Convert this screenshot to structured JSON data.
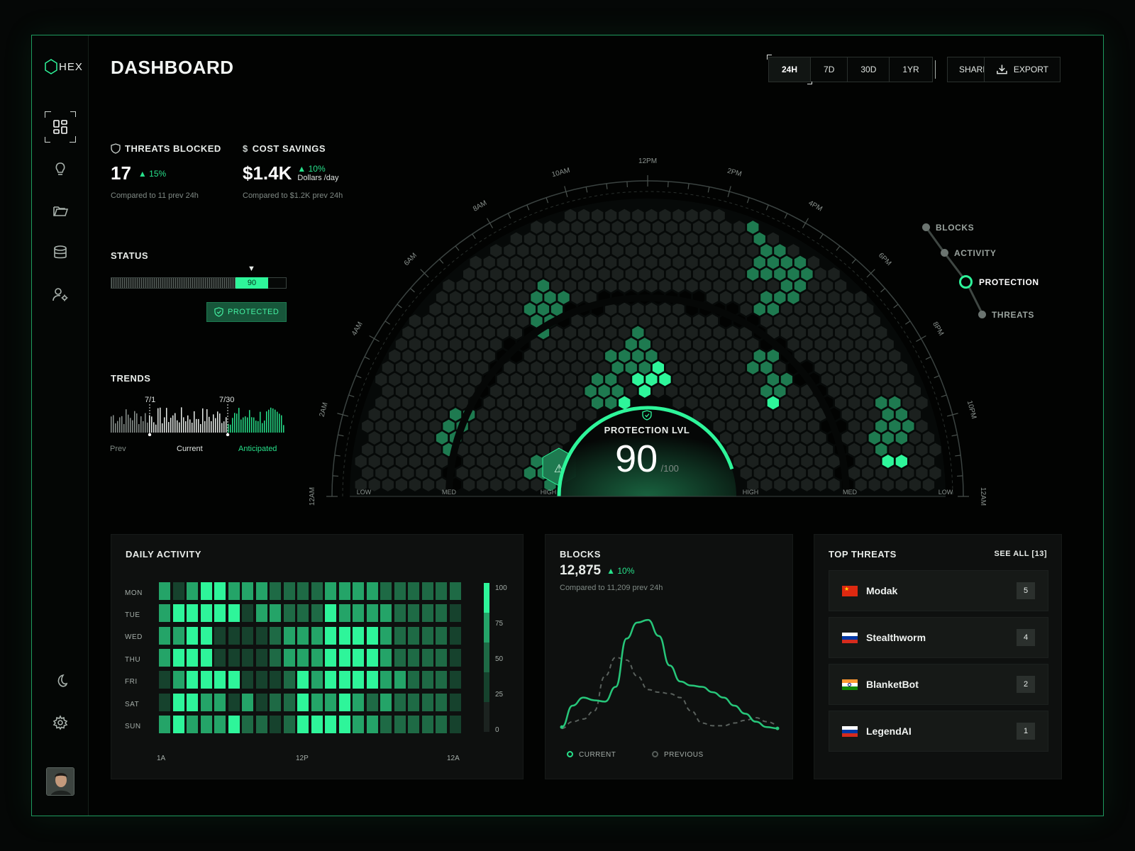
{
  "app": {
    "logo_text": "HEX"
  },
  "sidebar": {
    "items": [
      {
        "id": "dashboard",
        "icon": "grid-icon",
        "active": true
      },
      {
        "id": "ideas",
        "icon": "lightbulb-icon"
      },
      {
        "id": "files",
        "icon": "folder-icon"
      },
      {
        "id": "database",
        "icon": "database-icon"
      },
      {
        "id": "users",
        "icon": "user-settings-icon"
      }
    ],
    "bottom": [
      {
        "id": "theme",
        "icon": "moon-icon"
      },
      {
        "id": "settings",
        "icon": "gear-icon"
      },
      {
        "id": "profile",
        "icon": "avatar"
      }
    ]
  },
  "header": {
    "title": "DASHBOARD",
    "ranges": [
      "24H",
      "7D",
      "30D",
      "1YR"
    ],
    "selected_range": "24H",
    "share_label": "SHARE",
    "export_label": "EXPORT"
  },
  "kpis": {
    "threats": {
      "label": "THREATS BLOCKED",
      "value": "17",
      "delta": "15%",
      "compare": "Compared to 11 prev 24h"
    },
    "savings": {
      "label": "COST SAVINGS",
      "value": "$1.4K",
      "delta": "10%",
      "unit": "Dollars /day",
      "compare": "Compared to $1.2K prev 24h"
    }
  },
  "status": {
    "label": "STATUS",
    "value": "90",
    "level": 0.9,
    "badge": "PROTECTED"
  },
  "trends": {
    "label": "TRENDS",
    "marker_1": "7/1",
    "marker_2": "7/30",
    "legend_prev": "Prev",
    "legend_current": "Current",
    "legend_anticipated": "Anticipated"
  },
  "radar": {
    "time_labels": [
      "12AM",
      "2AM",
      "4AM",
      "6AM",
      "8AM",
      "10AM",
      "12PM",
      "2PM",
      "4PM",
      "6PM",
      "8PM",
      "10PM",
      "12AM"
    ],
    "level_labels": [
      "LOW",
      "MED",
      "HIGH",
      "HIGH",
      "MED",
      "LOW"
    ],
    "gauge_title": "PROTECTION LVL",
    "gauge_value": "90",
    "gauge_max": "/100",
    "gauge_fraction": 0.9
  },
  "layers": {
    "items": [
      "BLOCKS",
      "ACTIVITY",
      "PROTECTION",
      "THREATS"
    ],
    "selected": "PROTECTION"
  },
  "daily_activity": {
    "title": "DAILY ACTIVITY",
    "days": [
      "MON",
      "TUE",
      "WED",
      "THU",
      "FRI",
      "SAT",
      "SUN"
    ],
    "x_labels": [
      "1A",
      "12P",
      "12A"
    ],
    "scale_labels": [
      "100",
      "75",
      "50",
      "25",
      "0"
    ],
    "colors": {
      "l0": "#1c2320",
      "l1": "#16422d",
      "l2": "#1e6a45",
      "l3": "#24a468",
      "l4": "#2ef59a"
    },
    "grid": [
      [
        3,
        1,
        3,
        4,
        4,
        3,
        3,
        3,
        2,
        2,
        2,
        2,
        3,
        3,
        3,
        3,
        2,
        2,
        2,
        2,
        2,
        2
      ],
      [
        3,
        4,
        4,
        4,
        4,
        4,
        1,
        3,
        3,
        2,
        2,
        2,
        4,
        3,
        3,
        3,
        3,
        2,
        2,
        2,
        2,
        1
      ],
      [
        3,
        3,
        4,
        4,
        1,
        1,
        1,
        1,
        2,
        3,
        3,
        3,
        4,
        4,
        4,
        4,
        3,
        2,
        2,
        2,
        2,
        1
      ],
      [
        3,
        4,
        4,
        4,
        1,
        1,
        1,
        1,
        2,
        3,
        3,
        3,
        4,
        4,
        4,
        4,
        3,
        2,
        2,
        2,
        2,
        1
      ],
      [
        1,
        3,
        4,
        4,
        4,
        4,
        1,
        1,
        1,
        2,
        4,
        3,
        4,
        4,
        4,
        4,
        3,
        3,
        2,
        2,
        2,
        1
      ],
      [
        1,
        4,
        4,
        3,
        3,
        1,
        3,
        1,
        2,
        2,
        4,
        3,
        3,
        4,
        3,
        2,
        3,
        2,
        2,
        2,
        2,
        1
      ],
      [
        3,
        4,
        3,
        3,
        3,
        4,
        2,
        2,
        1,
        2,
        4,
        4,
        4,
        4,
        3,
        3,
        2,
        2,
        2,
        2,
        2,
        1
      ]
    ]
  },
  "blocks": {
    "title": "BLOCKS",
    "value": "12,875",
    "delta": "10%",
    "compare": "Compared to 11,209 prev 24h",
    "legend_current": "CURRENT",
    "legend_previous": "PREVIOUS",
    "chart_data": {
      "type": "line",
      "x": [
        0,
        1,
        2,
        3,
        4,
        5,
        6,
        7,
        8,
        9,
        10,
        11,
        12,
        13,
        14,
        15,
        16,
        17,
        18,
        19,
        20
      ],
      "series": [
        {
          "name": "CURRENT",
          "values": [
            2,
            18,
            24,
            22,
            21,
            32,
            68,
            80,
            82,
            70,
            48,
            36,
            33,
            32,
            28,
            24,
            18,
            12,
            6,
            2,
            1
          ]
        },
        {
          "name": "PREVIOUS",
          "values": [
            1,
            6,
            8,
            14,
            40,
            54,
            52,
            40,
            30,
            28,
            27,
            24,
            14,
            5,
            3,
            3,
            5,
            7,
            9,
            6,
            4
          ]
        }
      ],
      "ylim": [
        0,
        90
      ]
    }
  },
  "top_threats": {
    "title": "TOP THREATS",
    "see_all": "SEE ALL [13]",
    "items": [
      {
        "name": "Modak",
        "count": "5",
        "flag": "cn"
      },
      {
        "name": "Stealthworm",
        "count": "4",
        "flag": "ru"
      },
      {
        "name": "BlanketBot",
        "count": "2",
        "flag": "in"
      },
      {
        "name": "LegendAI",
        "count": "1",
        "flag": "ru"
      }
    ]
  },
  "theme": {
    "accent": "#2ef59a",
    "accent_dim": "#1e6a45",
    "border": "#1e9a5e"
  }
}
